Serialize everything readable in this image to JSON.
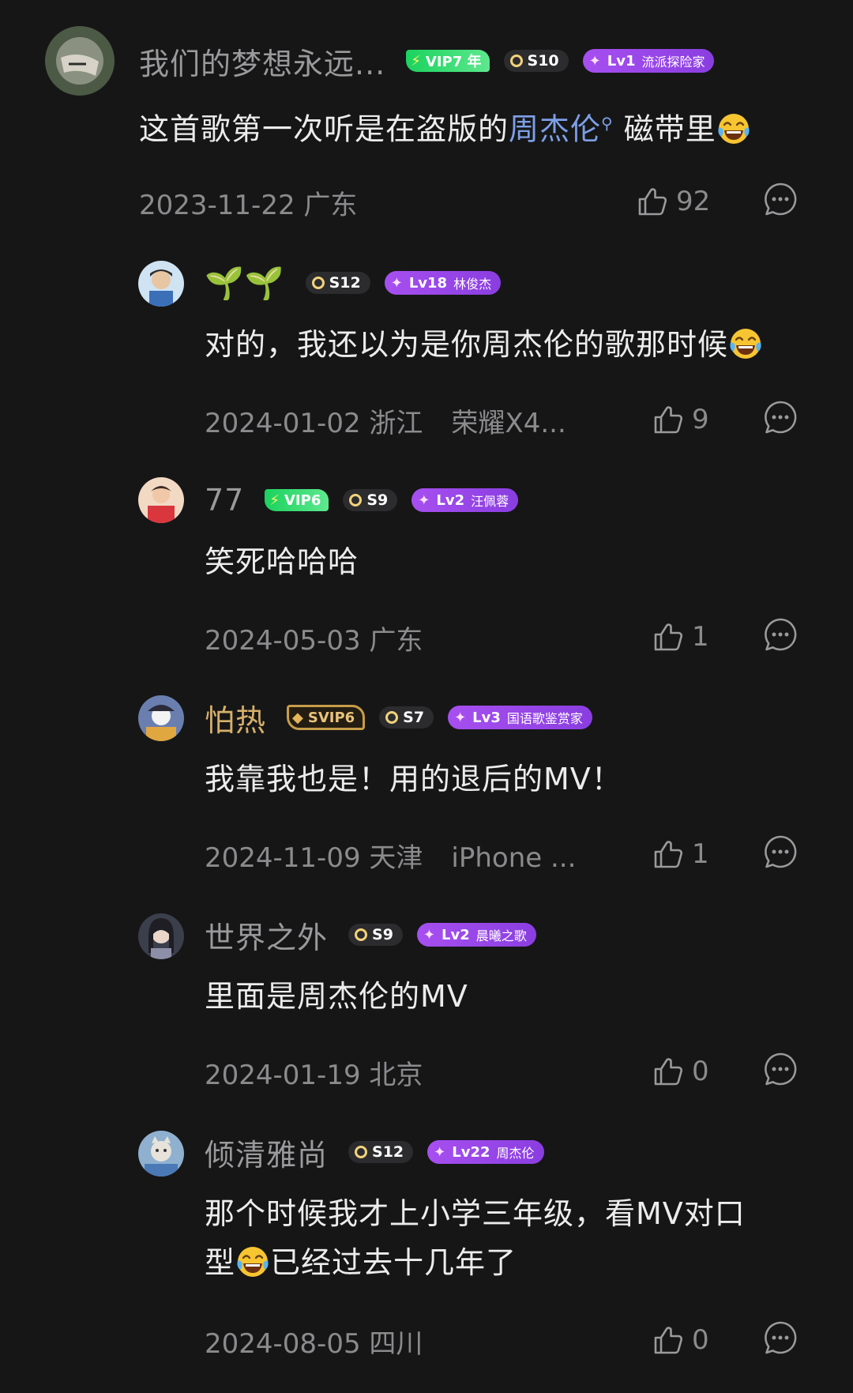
{
  "comments": [
    {
      "username": "我们的梦想永远...",
      "vip": "VIP7 年",
      "s_level": "S10",
      "lv": "Lv1",
      "lv_name": "流派探险家",
      "text_before": "这首歌第一次听是在盗版的",
      "link": "周杰伦",
      "text_after": " 磁带里",
      "date": "2023-11-22 广东",
      "device": "",
      "likes": "92"
    },
    {
      "username": "🌱🌱",
      "s_level": "S12",
      "lv": "Lv18",
      "lv_name": "林俊杰",
      "text": "对的，我还以为是你周杰伦的歌那时候",
      "date": "2024-01-02 浙江",
      "device": "荣耀X4...",
      "likes": "9"
    },
    {
      "username": "77",
      "vip": "VIP6",
      "s_level": "S9",
      "lv": "Lv2",
      "lv_name": "汪佩蓉",
      "text": "笑死哈哈哈",
      "date": "2024-05-03 广东",
      "device": "",
      "likes": "1"
    },
    {
      "username": "怕热",
      "svip": "SVIP6",
      "s_level": "S7",
      "lv": "Lv3",
      "lv_name": "国语歌鉴赏家",
      "text": "我靠我也是！用的退后的MV！",
      "date": "2024-11-09 天津",
      "device": "iPhone ...",
      "likes": "1"
    },
    {
      "username": "世界之外",
      "s_level": "S9",
      "lv": "Lv2",
      "lv_name": "晨曦之歌",
      "text": "里面是周杰伦的MV",
      "date": "2024-01-19 北京",
      "device": "",
      "likes": "0"
    },
    {
      "username": "倾清雅尚",
      "s_level": "S12",
      "lv": "Lv22",
      "lv_name": "周杰伦",
      "text_line1": "那个时候我才上小学三年级，看MV对口",
      "text_line2_a": "型",
      "text_line2_b": "已经过去十几年了",
      "date": "2024-08-05 四川",
      "device": "",
      "likes": "0"
    }
  ],
  "colors": {
    "background": "#161617",
    "username": "#9a9a9c",
    "svip_username": "#d6b06a",
    "link": "#7d9fe6",
    "meta": "#8b8b8d",
    "vip_green": "#1bd25e",
    "lv_purple": "#a74ff0"
  },
  "icons": {
    "like": "thumbs-up-icon",
    "reply": "comment-bubble-icon",
    "emoji": "laughing-tears-emoji"
  }
}
